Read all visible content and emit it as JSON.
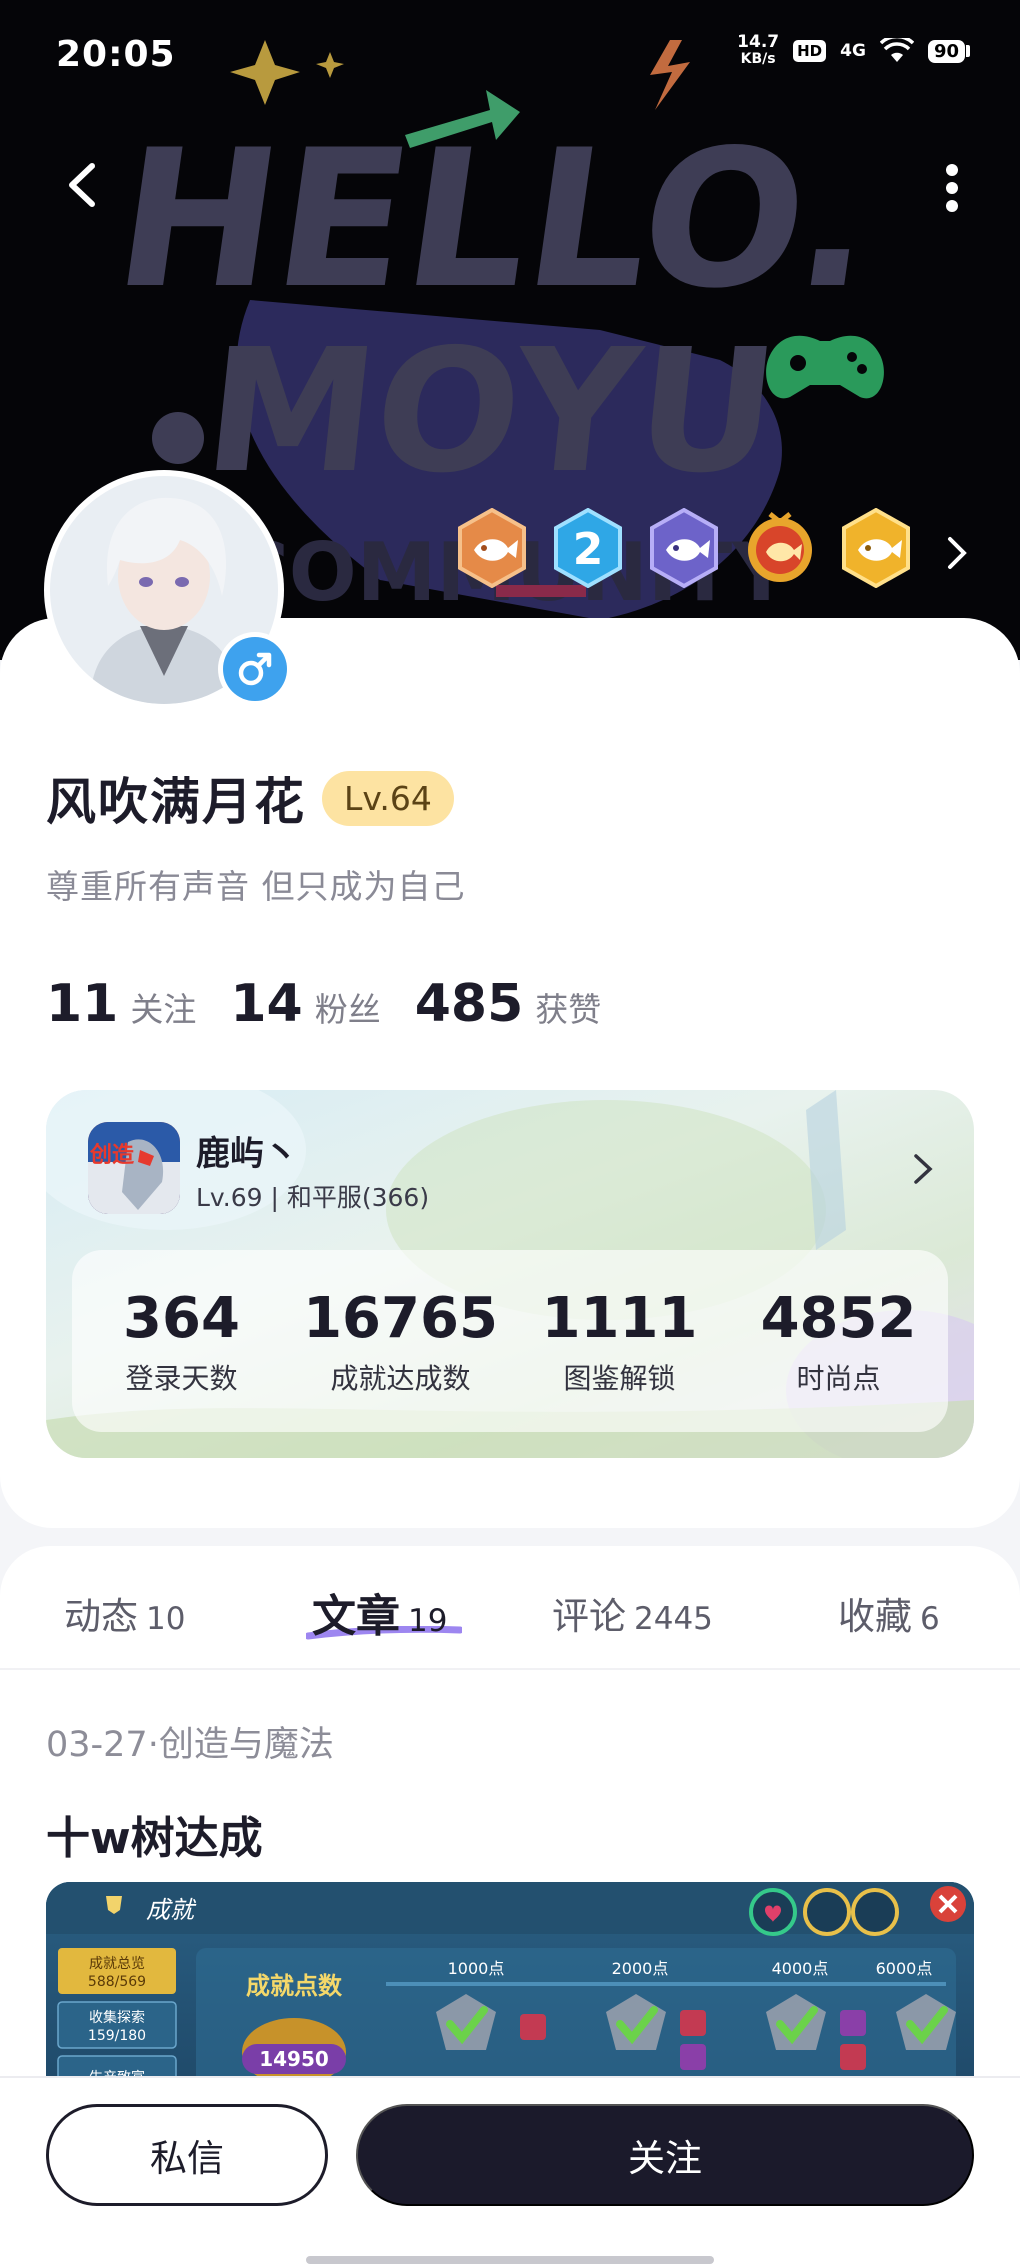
{
  "status_bar": {
    "time": "20:05",
    "net_speed_value": "14.7",
    "net_speed_unit": "KB/s",
    "hd": "HD",
    "signal": "4G",
    "battery": "90"
  },
  "header": {
    "banner_text_line1": "HELLO.",
    "banner_text_line2": "MOYU",
    "banner_text_line3": "COMMUNITY"
  },
  "profile": {
    "nickname": "风吹满月花",
    "level": "Lv.64",
    "signature": "尊重所有声音 但只成为自己",
    "gender": "male",
    "counts": [
      {
        "num": "11",
        "label": "关注"
      },
      {
        "num": "14",
        "label": "粉丝"
      },
      {
        "num": "485",
        "label": "获赞"
      }
    ],
    "badges": [
      "fish-badge-bronze",
      "level-2-badge",
      "fish-badge-purple",
      "fish-badge-red",
      "fish-badge-gold"
    ]
  },
  "game_card": {
    "role_name": "鹿屿丶",
    "role_info": "Lv.69 | 和平服(366)",
    "game_icon_text": "创造",
    "stats": [
      {
        "value": "364",
        "label": "登录天数"
      },
      {
        "value": "16765",
        "label": "成就达成数"
      },
      {
        "value": "1111",
        "label": "图鉴解锁"
      },
      {
        "value": "4852",
        "label": "时尚点"
      }
    ]
  },
  "tabs": [
    {
      "label": "动态",
      "count": "10",
      "active": false
    },
    {
      "label": "文章",
      "count": "19",
      "active": true
    },
    {
      "label": "评论",
      "count": "2445",
      "active": false
    },
    {
      "label": "收藏",
      "count": "6",
      "active": false
    }
  ],
  "post": {
    "meta": "03-27·创造与魔法",
    "title": "十w树达成",
    "image": {
      "header": "成就",
      "side_items": [
        "成就总览",
        "588/569",
        "收集探索",
        "159/180",
        "生产致富"
      ],
      "score_label": "成就点数",
      "score_value": "14950",
      "milestones": [
        "1000点",
        "2000点",
        "4000点",
        "6000点"
      ]
    }
  },
  "actions": {
    "message": "私信",
    "follow": "关注"
  },
  "colors": {
    "accent_dark": "#1b1a2b",
    "level_badge_bg": "#fde3a2",
    "gender_blue": "#3ea2ee",
    "tab_underline": "#9d86f0"
  }
}
